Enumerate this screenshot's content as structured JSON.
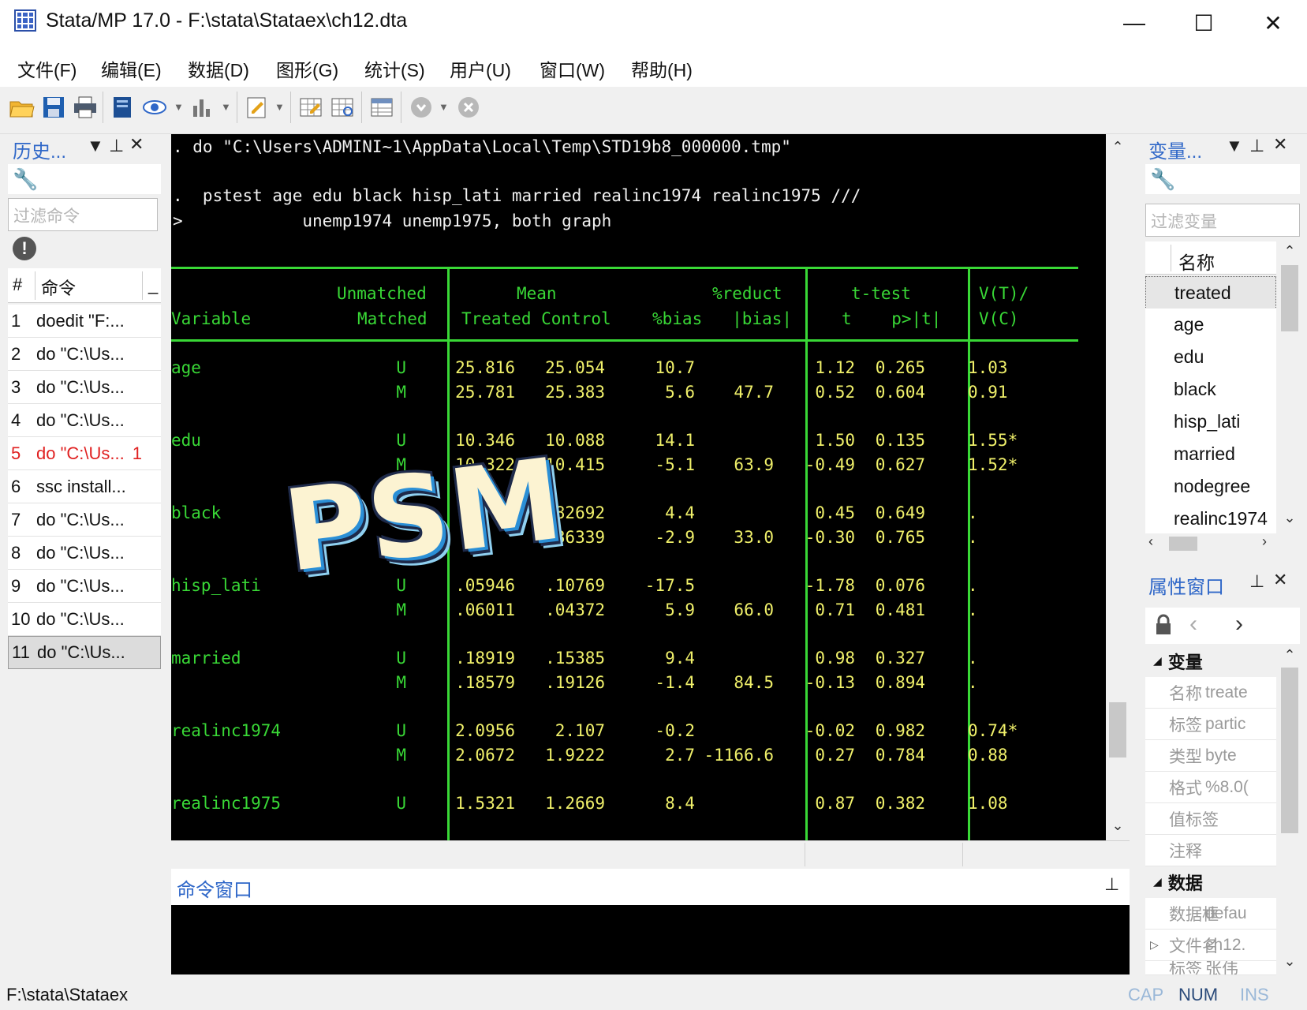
{
  "window": {
    "title": "Stata/MP 17.0 - F:\\stata\\Stataex\\ch12.dta",
    "minimize": "—",
    "maximize": "☐",
    "close": "✕"
  },
  "menu": [
    "文件(F)",
    "编辑(E)",
    "数据(D)",
    "图形(G)",
    "统计(S)",
    "用户(U)",
    "窗口(W)",
    "帮助(H)"
  ],
  "toolbar": [
    "open-icon",
    "save-icon",
    "print-icon",
    "log-icon",
    "viewer-icon",
    "graph-icon",
    "do-editor-icon",
    "data-editor-icon",
    "data-browser-icon",
    "variables-manager-icon",
    "more-icon",
    "break-icon"
  ],
  "history": {
    "title": "历史...",
    "filter_placeholder": "过滤命令",
    "col_num": "#",
    "col_cmd": "命令",
    "col_extra": "_",
    "rows": [
      {
        "n": "1",
        "cmd": "doedit \"F:..."
      },
      {
        "n": "2",
        "cmd": "do \"C:\\Us..."
      },
      {
        "n": "3",
        "cmd": "do \"C:\\Us..."
      },
      {
        "n": "4",
        "cmd": "do \"C:\\Us..."
      },
      {
        "n": "5",
        "cmd": "do \"C:\\Us...",
        "extra": "1",
        "error": true
      },
      {
        "n": "6",
        "cmd": "ssc install..."
      },
      {
        "n": "7",
        "cmd": "do \"C:\\Us..."
      },
      {
        "n": "8",
        "cmd": "do \"C:\\Us..."
      },
      {
        "n": "9",
        "cmd": "do \"C:\\Us..."
      },
      {
        "n": "10",
        "cmd": "do \"C:\\Us..."
      },
      {
        "n": "11",
        "cmd": "do \"C:\\Us...",
        "selected": true
      }
    ]
  },
  "results": {
    "line1": ". do \"C:\\Users\\ADMINI~1\\AppData\\Local\\Temp\\STD19b8_000000.tmp\"",
    "line2": ".  pstest age edu black hisp_lati married realinc1974 realinc1975 ///",
    "line3": ">            unemp1974 unemp1975, both graph",
    "header": {
      "unmatched": "Unmatched",
      "matched": "Matched",
      "variable": "Variable",
      "mean": "Mean",
      "treated_control": "Treated Control",
      "reduct": "%reduct",
      "bias_cols": "%bias   |bias|",
      "ttest": "t-test",
      "t_p": "t    p>|t|",
      "vratio": "V(T)/",
      "vc": "V(C)"
    },
    "rows": [
      {
        "var": "age",
        "um": "U",
        "treated": "25.816",
        "control": "25.054",
        "bias": "10.7",
        "reduct": "",
        "t": "1.12",
        "p": "0.265",
        "v": "1.03"
      },
      {
        "var": "",
        "um": "M",
        "treated": "25.781",
        "control": "25.383",
        "bias": "5.6",
        "reduct": "47.7",
        "t": "0.52",
        "p": "0.604",
        "v": "0.91"
      },
      {
        "var": "edu",
        "um": "U",
        "treated": "10.346",
        "control": "10.088",
        "bias": "14.1",
        "reduct": "",
        "t": "1.50",
        "p": "0.135",
        "v": "1.55*"
      },
      {
        "var": "",
        "um": "M",
        "treated": "10.322",
        "control": "10.415",
        "bias": "-5.1",
        "reduct": "63.9",
        "t": "-0.49",
        "p": "0.627",
        "v": "1.52*"
      },
      {
        "var": "black",
        "um": "U",
        "treated": "",
        "control": "82692",
        "bias": "4.4",
        "reduct": "",
        "t": "0.45",
        "p": "0.649",
        "v": "."
      },
      {
        "var": "",
        "um": "",
        "treated": "",
        "control": "86339",
        "bias": "-2.9",
        "reduct": "33.0",
        "t": "-0.30",
        "p": "0.765",
        "v": "."
      },
      {
        "var": "hisp_lati",
        "um": "U",
        "treated": ".05946",
        "control": ".10769",
        "bias": "-17.5",
        "reduct": "",
        "t": "-1.78",
        "p": "0.076",
        "v": "."
      },
      {
        "var": "",
        "um": "M",
        "treated": ".06011",
        "control": ".04372",
        "bias": "5.9",
        "reduct": "66.0",
        "t": "0.71",
        "p": "0.481",
        "v": "."
      },
      {
        "var": "married",
        "um": "U",
        "treated": ".18919",
        "control": ".15385",
        "bias": "9.4",
        "reduct": "",
        "t": "0.98",
        "p": "0.327",
        "v": "."
      },
      {
        "var": "",
        "um": "M",
        "treated": ".18579",
        "control": ".19126",
        "bias": "-1.4",
        "reduct": "84.5",
        "t": "-0.13",
        "p": "0.894",
        "v": "."
      },
      {
        "var": "realinc1974",
        "um": "U",
        "treated": "2.0956",
        "control": "2.107",
        "bias": "-0.2",
        "reduct": "",
        "t": "-0.02",
        "p": "0.982",
        "v": "0.74*"
      },
      {
        "var": "",
        "um": "M",
        "treated": "2.0672",
        "control": "1.9222",
        "bias": "2.7",
        "reduct": "-1166.6",
        "t": "0.27",
        "p": "0.784",
        "v": "0.88"
      },
      {
        "var": "realinc1975",
        "um": "U",
        "treated": "1.5321",
        "control": "1.2669",
        "bias": "8.4",
        "reduct": "",
        "t": "0.87",
        "p": "0.382",
        "v": "1.08"
      }
    ]
  },
  "command": {
    "title": "命令窗口"
  },
  "variables": {
    "title": "变量...",
    "filter_placeholder": "过滤变量",
    "col_name": "名称",
    "items": [
      "treated",
      "age",
      "edu",
      "black",
      "hisp_lati",
      "married",
      "nodegree",
      "realinc1974"
    ]
  },
  "properties": {
    "title": "属性窗口",
    "section_var": "变量",
    "var_props": [
      {
        "k": "名称",
        "v": "treate"
      },
      {
        "k": "标签",
        "v": "partic"
      },
      {
        "k": "类型",
        "v": "byte"
      },
      {
        "k": "格式",
        "v": "%8.0("
      },
      {
        "k": "值标签",
        "v": ""
      },
      {
        "k": "注释",
        "v": ""
      }
    ],
    "section_data": "数据",
    "data_props": [
      {
        "k": "数据框",
        "v": "defau"
      },
      {
        "k": "文件名",
        "v": "ch12."
      },
      {
        "k": "标签",
        "v": "张伟"
      }
    ]
  },
  "status": {
    "path": "F:\\stata\\Stataex",
    "cap": "CAP",
    "num": "NUM",
    "ins": "INS"
  },
  "overlay": "PSM"
}
